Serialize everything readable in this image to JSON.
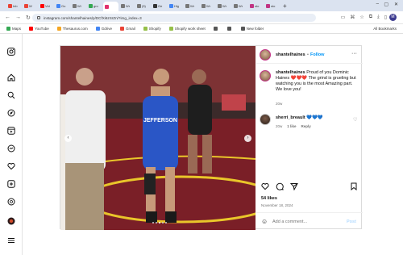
{
  "browser": {
    "tabs": [
      {
        "label": "Inb",
        "color": "#ea4335"
      },
      {
        "label": "W",
        "color": "#ea4335"
      },
      {
        "label": "Vid",
        "color": "#ff0000"
      },
      {
        "label": "Go",
        "color": "#4285f4"
      },
      {
        "label": "Wi",
        "color": "#777777"
      },
      {
        "label": "gro",
        "color": "#34a853"
      },
      {
        "label": "",
        "color": "#e1306c"
      },
      {
        "label": "Wr",
        "color": "#777777"
      },
      {
        "label": "(5)",
        "color": "#777777"
      },
      {
        "label": "Ge",
        "color": "#333333"
      },
      {
        "label": "Hig",
        "color": "#4285f4"
      },
      {
        "label": "Wr",
        "color": "#777777"
      },
      {
        "label": "Wr",
        "color": "#777777"
      },
      {
        "label": "Wr",
        "color": "#777777"
      },
      {
        "label": "Wr",
        "color": "#777777"
      },
      {
        "label": "sto",
        "color": "#c13584"
      },
      {
        "label": "sto",
        "color": "#c13584"
      }
    ],
    "url": "instagram.com/shantelhaines/p/DCfXi6zSrZn/?img_index=3",
    "profile_initial": "M",
    "bookmarks": [
      {
        "label": "Maps",
        "color": "#34a853"
      },
      {
        "label": "YouTube",
        "color": "#ff0000"
      },
      {
        "label": "Thesaurus.com",
        "color": "#f5a623"
      },
      {
        "label": "Gdrive",
        "color": "#4285f4"
      },
      {
        "label": "Gmail",
        "color": "#ea4335"
      },
      {
        "label": "Shopify",
        "color": "#95bf47"
      },
      {
        "label": "Shopify work sheet",
        "color": "#95bf47"
      },
      {
        "label": "",
        "color": "#555555"
      },
      {
        "label": "",
        "color": "#555555"
      },
      {
        "label": "New folder",
        "color": "#555555"
      }
    ],
    "all_bookmarks": "All Bookmarks"
  },
  "post": {
    "username": "shantelhaines",
    "follow_label": "Follow",
    "caption_user": "shantelhaines",
    "caption_text": "Proud of you Dominic Haines ❤️❤️❤️ The grind is grueling but watching you is the most Amazing part. We love you!",
    "caption_age": "20w",
    "comment_user": "sherri_breault",
    "comment_text": "💙💙💙",
    "comment_age": "20w",
    "comment_likes": "1 like",
    "reply_label": "Reply",
    "likes": "54 likes",
    "date": "November 18, 2024",
    "add_comment_placeholder": "Add a comment...",
    "post_label": "Post",
    "singlet_text": "JEFFERSON",
    "total_slides": 5,
    "current_slide": 3
  }
}
